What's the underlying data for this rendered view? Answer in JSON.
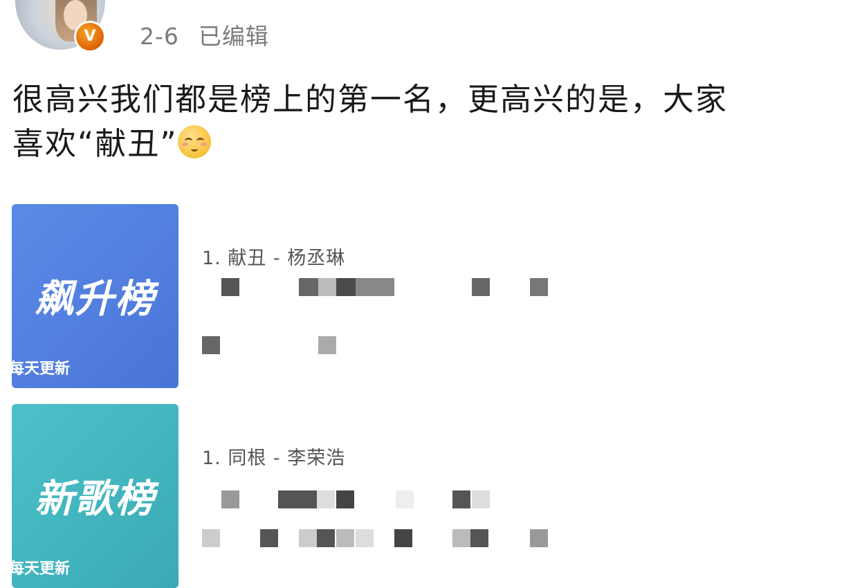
{
  "post": {
    "date": "2-6",
    "edited_label": "已编辑",
    "text_line1": "很高兴我们都是榜上的第一名，更高兴的是，大家",
    "text_line2": "喜欢“献丑”",
    "emoji": "shy-smile-emoji"
  },
  "badge": {
    "letter": "V",
    "color": "#e8730f"
  },
  "cards": [
    {
      "chart_title": "飙升榜",
      "chart_sub": "每天更新",
      "track": "1. 献丑 - 杨丞琳",
      "color": "#4a7be0"
    },
    {
      "chart_title": "新歌榜",
      "chart_sub": "每天更新",
      "track": "1. 同根 - 李荣浩",
      "color": "#3fb6bf"
    }
  ]
}
